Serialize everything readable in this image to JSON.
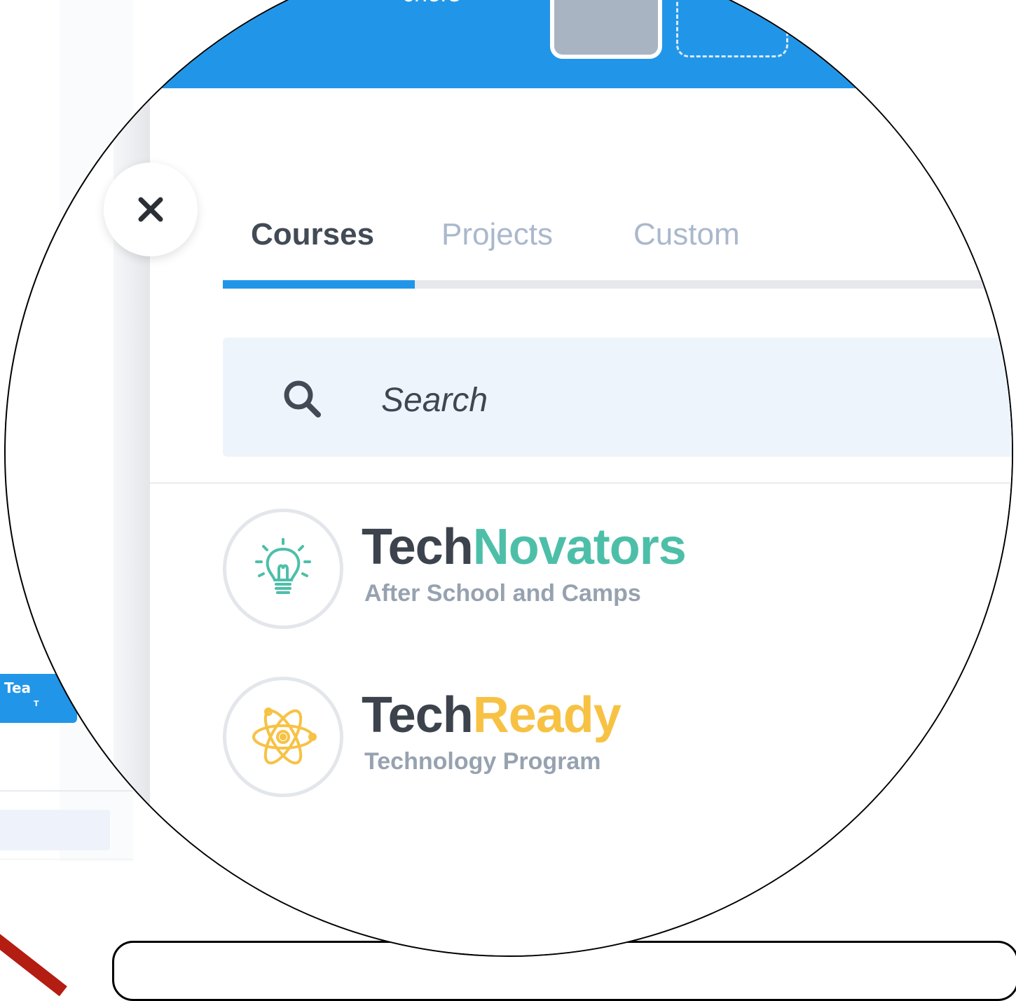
{
  "background": {
    "teach_button_label": "Tea",
    "teach_button_sub": "T"
  },
  "topbar": {
    "title_fragment": "chers"
  },
  "tabs": [
    {
      "label": "Courses",
      "active": true
    },
    {
      "label": "Projects",
      "active": false
    },
    {
      "label": "Custom",
      "active": false
    }
  ],
  "search": {
    "placeholder": "Search",
    "icon": "search-icon"
  },
  "close": {
    "icon": "close-icon",
    "glyph": "✕"
  },
  "courses": [
    {
      "name_part1": "Tech",
      "name_part2": "Novators",
      "subtitle": "After School and Camps",
      "accent_color": "#4dbfa9",
      "icon": "lightbulb-icon"
    },
    {
      "name_part1": "Tech",
      "name_part2": "Ready",
      "subtitle": "Technology Program",
      "accent_color": "#f7c244",
      "icon": "atom-icon"
    }
  ],
  "colors": {
    "primary": "#2196e8",
    "tab_active": "#424a55",
    "tab_inactive": "#aab8cc",
    "search_bg": "#eef4fc"
  }
}
